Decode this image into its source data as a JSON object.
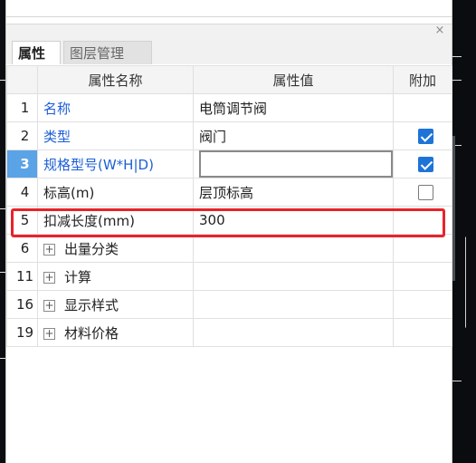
{
  "tabs": [
    {
      "label": "属性"
    },
    {
      "label": "图层管理"
    }
  ],
  "close_glyph": "×",
  "table": {
    "headers": {
      "index": "",
      "name": "属性名称",
      "value": "属性值",
      "extra": "附加"
    },
    "rows": [
      {
        "index": "1",
        "name": "名称",
        "value": "电筒调节阀",
        "checkbox": null
      },
      {
        "index": "2",
        "name": "类型",
        "value": "阀门",
        "checkbox": true
      },
      {
        "index": "3",
        "name": "规格型号(W*H|D)",
        "value": "",
        "checkbox": true
      },
      {
        "index": "4",
        "name": "标高(m)",
        "value": "层顶标高",
        "checkbox": false
      },
      {
        "index": "5",
        "name": "扣减长度(mm)",
        "value": "300",
        "checkbox": null
      },
      {
        "index": "6",
        "name": "出量分类",
        "value": "",
        "checkbox": null,
        "expander": "+"
      },
      {
        "index": "11",
        "name": "计算",
        "value": "",
        "checkbox": null,
        "expander": "+"
      },
      {
        "index": "16",
        "name": "显示样式",
        "value": "",
        "checkbox": null,
        "expander": "+"
      },
      {
        "index": "19",
        "name": "材料价格",
        "value": "",
        "checkbox": null,
        "expander": "+"
      }
    ]
  },
  "colors": {
    "accent": "#5aa3e6",
    "checkbox": "#1e74d6",
    "link_text": "#1d5fd6",
    "highlight": "#e8232a"
  }
}
